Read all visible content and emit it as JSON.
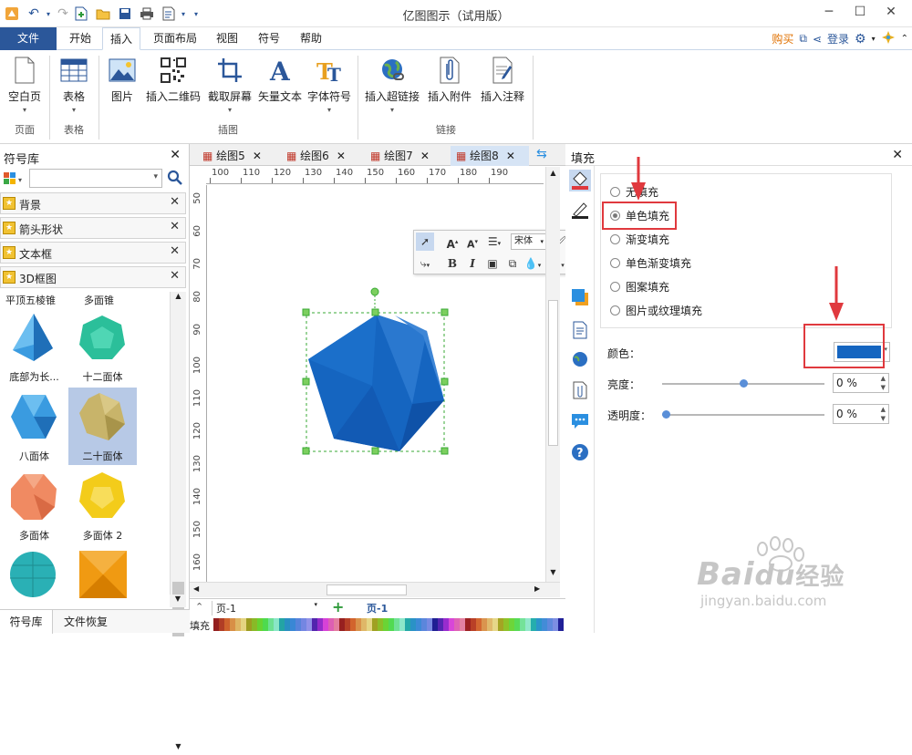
{
  "app": {
    "title": "亿图图示（试用版）"
  },
  "colors": {
    "accent": "#2b579a",
    "shape_fill": "#1565c0",
    "highlight_red": "#e0393e",
    "selected_tab_bg": "#d6e4f5"
  },
  "menu": {
    "tabs": [
      "文件",
      "开始",
      "插入",
      "页面布局",
      "视图",
      "符号",
      "帮助"
    ],
    "active": "插入",
    "right": {
      "buy": "购买",
      "login": "登录"
    }
  },
  "ribbon": {
    "buttons": {
      "blank_page": "空白页",
      "table": "表格",
      "picture": "图片",
      "qrcode": "插入二维码",
      "screenshot": "截取屏幕",
      "vector_text": "矢量文本",
      "font_symbol": "字体符号",
      "hyperlink": "插入超链接",
      "attachment": "插入附件",
      "annotation": "插入注释"
    },
    "groups": {
      "page": "页面",
      "table": "表格",
      "illustration": "插图",
      "link": "链接"
    }
  },
  "library": {
    "title": "符号库",
    "categories": [
      "背景",
      "箭头形状",
      "文本框",
      "3D框图"
    ],
    "headers": [
      "平顶五棱锥",
      "多面锥"
    ],
    "shapes": [
      "底部为长...",
      "十二面体",
      "八面体",
      "二十面体",
      "多面体",
      "多面体 2"
    ],
    "bottom_tabs": {
      "library": "符号库",
      "recovery": "文件恢复"
    }
  },
  "doc_tabs": [
    "绘图5",
    "绘图6",
    "绘图7",
    "绘图8"
  ],
  "ruler": {
    "h": [
      "100",
      "110",
      "120",
      "130",
      "140",
      "150",
      "160",
      "170",
      "180",
      "190"
    ],
    "v": [
      "50",
      "60",
      "70",
      "80",
      "90",
      "100",
      "110",
      "120",
      "130",
      "140",
      "150",
      "160"
    ]
  },
  "floating_toolbar": {
    "font_name": "宋体"
  },
  "pagebar": {
    "page_select": "页-1",
    "page_tab": "页-1"
  },
  "palette_label": "填充",
  "fill_panel": {
    "title": "填充",
    "options": [
      "无填充",
      "单色填充",
      "渐变填充",
      "单色渐变填充",
      "图案填充",
      "图片或纹理填充"
    ],
    "selected": "单色填充",
    "color_label": "颜色：",
    "brightness_label": "亮度：",
    "brightness_value": "0 %",
    "brightness": 0.5,
    "transparency_label": "透明度：",
    "transparency_value": "0 %",
    "transparency": 0.0
  },
  "watermark": {
    "brand": "Bai",
    "brand_cn": "经验",
    "url": "jingyan.baidu.com"
  }
}
